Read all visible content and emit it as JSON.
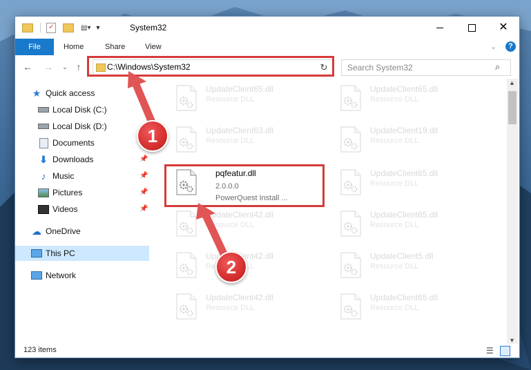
{
  "window": {
    "title": "System32",
    "controls": {
      "minimize": "minimize-icon",
      "maximize": "maximize-icon",
      "close": "close-icon"
    }
  },
  "ribbon": {
    "tabs": [
      {
        "label": "File",
        "active": true
      },
      {
        "label": "Home"
      },
      {
        "label": "Share"
      },
      {
        "label": "View"
      }
    ]
  },
  "address_bar": {
    "path": "C:\\Windows\\System32",
    "refresh_icon": "refresh-icon"
  },
  "search": {
    "placeholder": "Search System32"
  },
  "sidebar": {
    "items": [
      {
        "label": "Quick access",
        "icon": "star-icon"
      },
      {
        "label": "Local Disk (C:)",
        "icon": "drive-icon"
      },
      {
        "label": "Local Disk (D:)",
        "icon": "drive-icon"
      },
      {
        "label": "Documents",
        "icon": "documents-icon",
        "pinned": true
      },
      {
        "label": "Downloads",
        "icon": "download-icon",
        "pinned": true
      },
      {
        "label": "Music",
        "icon": "music-icon",
        "pinned": true
      },
      {
        "label": "Pictures",
        "icon": "pictures-icon",
        "pinned": true
      },
      {
        "label": "Videos",
        "icon": "videos-icon",
        "pinned": true
      },
      {
        "label": "OneDrive",
        "icon": "cloud-icon"
      },
      {
        "label": "This PC",
        "icon": "computer-icon",
        "selected": true
      },
      {
        "label": "Network",
        "icon": "network-icon"
      }
    ]
  },
  "files": [
    {
      "name": "UpdateClient65.dll",
      "version": "",
      "description": "Resource DLL",
      "highlight": false
    },
    {
      "name": "UpdateClient65.dll",
      "version": "",
      "description": "Resource DLL",
      "highlight": false
    },
    {
      "name": "UpdateClient63.dll",
      "version": "",
      "description": "Resource DLL",
      "highlight": false
    },
    {
      "name": "UpdateClient19.dll",
      "version": "",
      "description": "Resource DLL",
      "highlight": false
    },
    {
      "name": "pqfeatur.dll",
      "version": "2.0.0.0",
      "description": "PowerQuest Install ...",
      "highlight": true
    },
    {
      "name": "UpdateClient65.dll",
      "version": "",
      "description": "Resource DLL",
      "highlight": false
    },
    {
      "name": "UpdateClient42.dll",
      "version": "",
      "description": "Resource DLL",
      "highlight": false
    },
    {
      "name": "UpdateClient65.dll",
      "version": "",
      "description": "Resource DLL",
      "highlight": false
    },
    {
      "name": "UpdateClient42.dll",
      "version": "",
      "description": "Resource DLL",
      "highlight": false
    },
    {
      "name": "UpdateClient5.dll",
      "version": "",
      "description": "Resource DLL",
      "highlight": false
    },
    {
      "name": "UpdateClient42.dll",
      "version": "",
      "description": "Resource DLL",
      "highlight": false
    },
    {
      "name": "UpdateClient65.dll",
      "version": "",
      "description": "Resource DLL",
      "highlight": false
    }
  ],
  "status": {
    "item_count": "123 items"
  },
  "callouts": [
    {
      "label": "1"
    },
    {
      "label": "2"
    }
  ],
  "colors": {
    "accent": "#1979ca",
    "highlight": "#d63a3a",
    "selected": "#cde8ff"
  }
}
